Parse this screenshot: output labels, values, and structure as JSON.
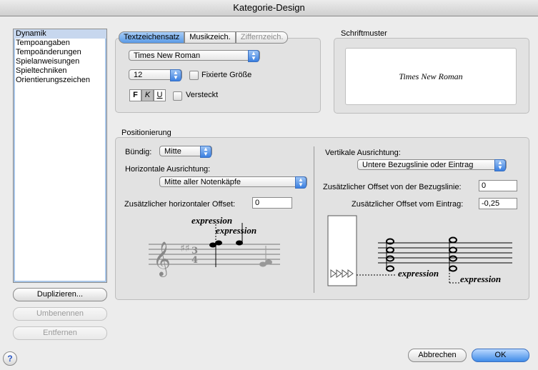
{
  "window": {
    "title": "Kategorie-Design"
  },
  "categories": {
    "items": [
      "Dynamik",
      "Tempoangaben",
      "Tempoänderungen",
      "Spielanweisungen",
      "Spieltechniken",
      "Orientierungszeichen"
    ],
    "selected": 0
  },
  "left_buttons": {
    "duplicate": "Duplizieren...",
    "rename": "Umbenennen",
    "remove": "Entfernen"
  },
  "tabs": [
    "Textzeichensatz",
    "Musikzeich.",
    "Ziffernzeich."
  ],
  "font": {
    "name": "Times New Roman",
    "size": "12",
    "fixed_size_label": "Fixierte Größe",
    "hidden_label": "Versteckt"
  },
  "format_buttons": {
    "bold": "F",
    "italic": "K",
    "underline": "U"
  },
  "sample": {
    "heading": "Schriftmuster",
    "text": "Times New Roman"
  },
  "positioning": {
    "heading": "Positionierung",
    "justify_label": "Bündig:",
    "justify_value": "Mitte",
    "horizontal_label": "Horizontale Ausrichtung:",
    "horizontal_value": "Mitte aller Notenkäpfe",
    "h_offset_label": "Zusätzlicher horizontaler Offset:",
    "h_offset_value": "0",
    "vertical_label": "Vertikale Ausrichtung:",
    "vertical_value": "Untere Bezugslinie oder Eintrag",
    "baseline_offset_label": "Zusätzlicher Offset von der Bezugslinie:",
    "baseline_offset_value": "0",
    "entry_offset_label": "Zusätzlicher Offset vom Eintrag:",
    "entry_offset_value": "-0,25",
    "example_word": "expression"
  },
  "dialog_buttons": {
    "cancel": "Abbrechen",
    "ok": "OK"
  },
  "help": {
    "glyph": "?"
  },
  "colors": {
    "accent": "#3f8ce8",
    "selection": "#c7d7ee"
  }
}
